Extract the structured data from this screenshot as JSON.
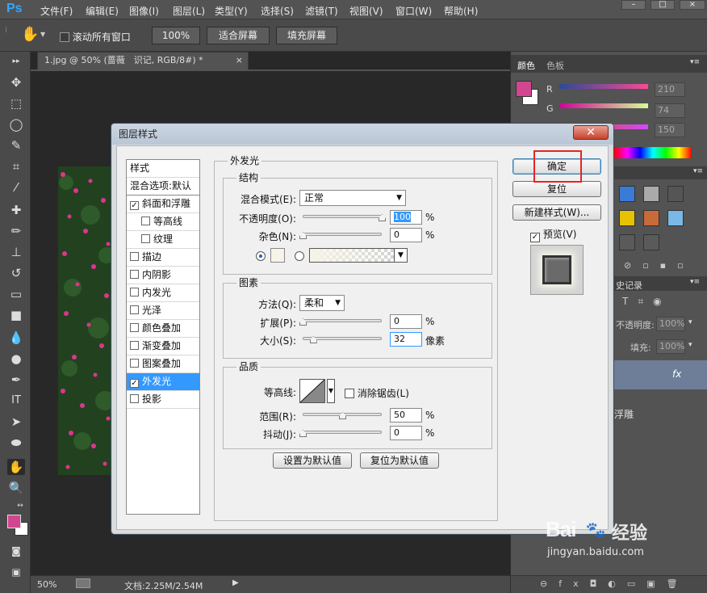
{
  "app": {
    "logo": "Ps"
  },
  "menu": [
    "文件(F)",
    "编辑(E)",
    "图像(I)",
    "图层(L)",
    "类型(Y)",
    "选择(S)",
    "滤镜(T)",
    "视图(V)",
    "窗口(W)",
    "帮助(H)"
  ],
  "options_bar": {
    "scroll_all_label": "滚动所有窗口",
    "zoom_button": "100%",
    "fit_screen": "适合屏幕",
    "fill_screen": "填充屏幕"
  },
  "document": {
    "tab_title": "1.jpg @ 50% (蔷薇　识记, RGB/8#) *",
    "close": "×"
  },
  "status": {
    "zoom": "50%",
    "doc_info": "文档:2.25M/2.54M"
  },
  "right_panel": {
    "color_tab": "颜色",
    "swatches_tab": "色板",
    "r_label": "R",
    "g_label": "G",
    "b_label": "B",
    "r_value": "210",
    "g_value": "74",
    "b_value": "150",
    "history_tab": "史记录",
    "opacity_label": "不透明度:",
    "opacity_value": "100%",
    "fill_label": "填充:",
    "fill_value": "100%",
    "layer_fx": "fx",
    "layer_effect_text": "浮雕",
    "fg_color": "#d2468f",
    "bg_color": "#ffffff"
  },
  "dialog": {
    "title": "图层样式",
    "close": "✕",
    "styles_header": "样式",
    "blend_default": "混合选项:默认",
    "styles": [
      {
        "label": "斜面和浮雕",
        "checked": "✓"
      },
      {
        "label": "等高线",
        "checked": ""
      },
      {
        "label": "纹理",
        "checked": ""
      },
      {
        "label": "描边",
        "checked": ""
      },
      {
        "label": "内阴影",
        "checked": ""
      },
      {
        "label": "内发光",
        "checked": ""
      },
      {
        "label": "光泽",
        "checked": ""
      },
      {
        "label": "颜色叠加",
        "checked": ""
      },
      {
        "label": "渐变叠加",
        "checked": ""
      },
      {
        "label": "图案叠加",
        "checked": ""
      },
      {
        "label": "外发光",
        "checked": "✓"
      },
      {
        "label": "投影",
        "checked": ""
      }
    ],
    "section_title": "外发光",
    "structure": {
      "legend": "结构",
      "blend_mode_label": "混合模式(E):",
      "blend_mode_value": "正常",
      "opacity_label": "不透明度(O):",
      "opacity_value": "100",
      "opacity_level": 1.0,
      "noise_label": "杂色(N):",
      "noise_value": "0",
      "noise_level": 0.0,
      "unit": "%"
    },
    "elements": {
      "legend": "图素",
      "method_label": "方法(Q):",
      "method_value": "柔和",
      "spread_label": "扩展(P):",
      "spread_value": "0",
      "spread_level": 0.0,
      "size_label": "大小(S):",
      "size_value": "32",
      "size_level": 0.13,
      "size_unit": "像素",
      "unit": "%"
    },
    "quality": {
      "legend": "品质",
      "contour_label": "等高线:",
      "antialias_label": "消除锯齿(L)",
      "range_label": "范围(R):",
      "range_value": "50",
      "range_level": 0.5,
      "jitter_label": "抖动(J):",
      "jitter_value": "0",
      "jitter_level": 0.0,
      "unit": "%"
    },
    "set_default": "设置为默认值",
    "reset_default": "复位为默认值",
    "ok": "确定",
    "reset": "复位",
    "new_style": "新建样式(W)...",
    "preview_label": "预览(V)"
  },
  "watermark": {
    "brand": "Bai",
    "brand2": "经验",
    "site": "jingyan.baidu.com"
  }
}
